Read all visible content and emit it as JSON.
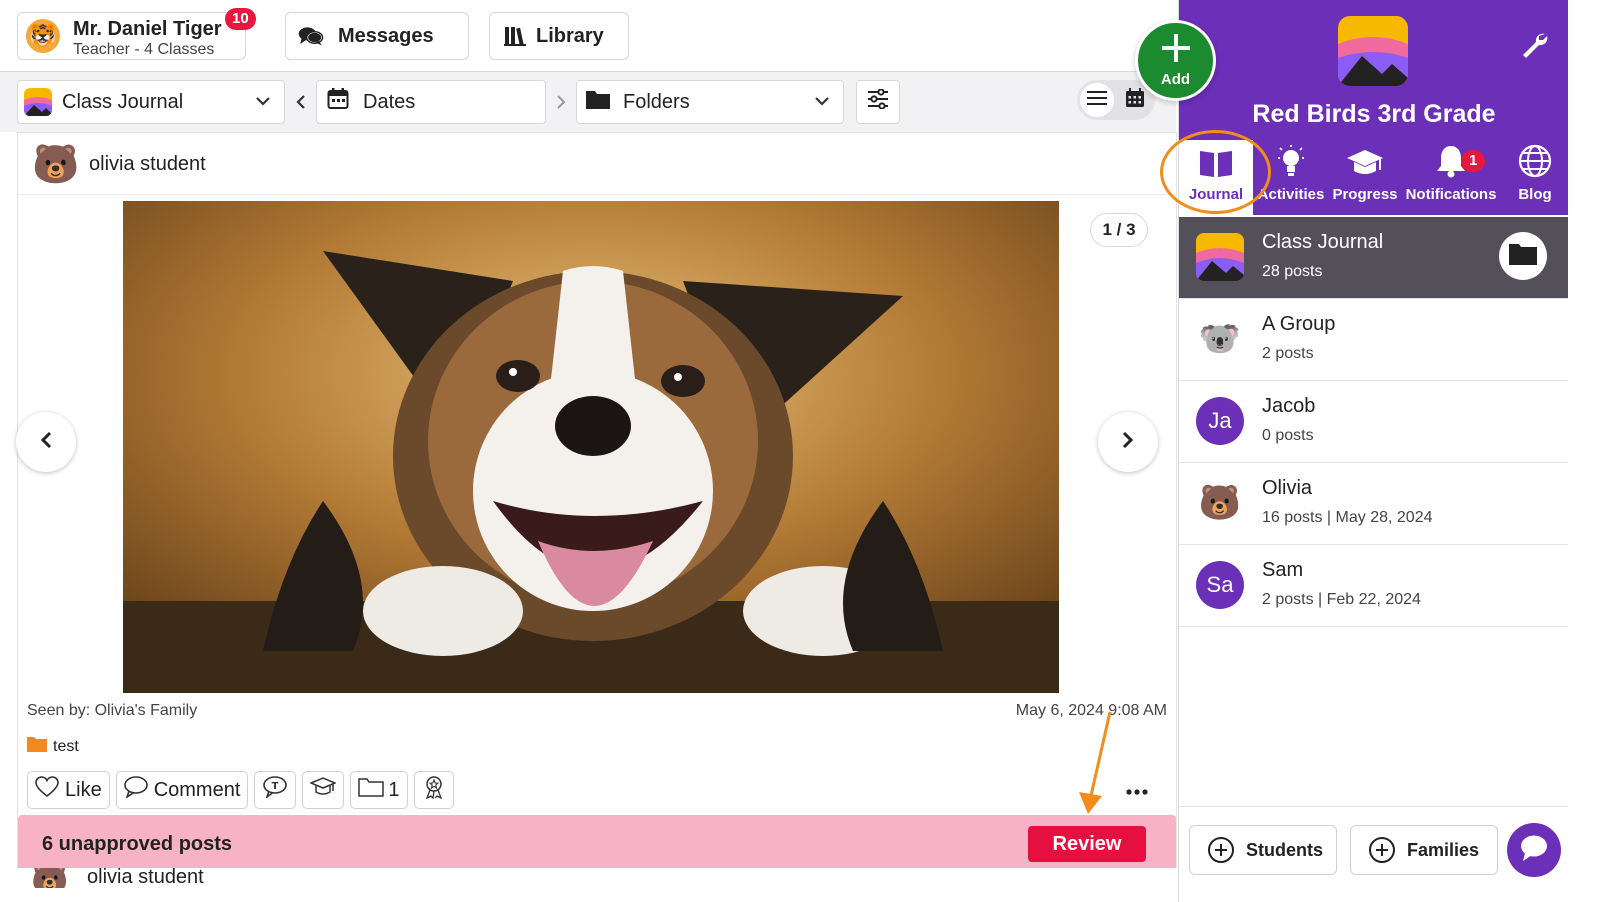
{
  "user": {
    "name": "Mr. Daniel Tiger",
    "subtitle": "Teacher - 4 Classes",
    "badge": "10",
    "avatar": "tiger-emoji"
  },
  "topnav": {
    "messages": "Messages",
    "library": "Library"
  },
  "add_fab": {
    "label": "Add"
  },
  "filters": {
    "journal": "Class Journal",
    "dates": "Dates",
    "folders": "Folders"
  },
  "post": {
    "author": "olivia student",
    "counter": "1 / 3",
    "seen_by": "Seen by: Olivia's Family",
    "date": "May 6, 2024 9:08 AM",
    "folder": "test",
    "actions": {
      "like": "Like",
      "comment": "Comment",
      "folder_count": "1"
    }
  },
  "unapproved": {
    "text": "6 unapproved posts",
    "review": "Review"
  },
  "next_post": {
    "author": "olivia student"
  },
  "class": {
    "name": "Red Birds 3rd Grade",
    "tabs": [
      {
        "label": "Journal",
        "icon": "book-icon"
      },
      {
        "label": "Activities",
        "icon": "lightbulb-icon"
      },
      {
        "label": "Progress",
        "icon": "graduation-cap-icon"
      },
      {
        "label": "Notifications",
        "icon": "bell-icon",
        "badge": "1"
      },
      {
        "label": "Blog",
        "icon": "globe-icon"
      }
    ],
    "groups": [
      {
        "name": "Class Journal",
        "sub": "28 posts"
      },
      {
        "name": "A Group",
        "sub": "2 posts"
      },
      {
        "name": "Jacob",
        "sub": "0 posts",
        "initials": "Ja"
      },
      {
        "name": "Olivia",
        "sub": "16 posts | May 28, 2024"
      },
      {
        "name": "Sam",
        "sub": "2 posts | Feb 22, 2024",
        "initials": "Sa"
      }
    ]
  },
  "footer": {
    "students": "Students",
    "families": "Families"
  },
  "colors": {
    "brand_purple": "#6c2fb8",
    "review_red": "#e5103f",
    "banner_pink": "#f7b2c6",
    "add_green": "#1c8a2e",
    "annotation_orange": "#f28c1a"
  }
}
